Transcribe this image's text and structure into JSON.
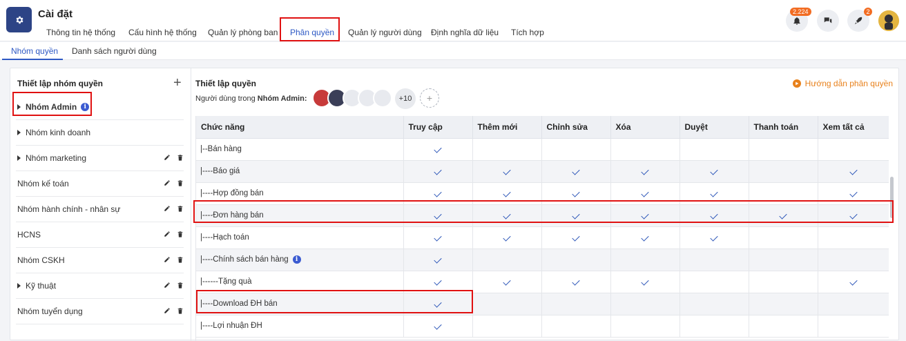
{
  "app": {
    "title": "Cài đặt"
  },
  "main_tabs": [
    {
      "label": "Thông tin hệ thống"
    },
    {
      "label": "Cấu hình hệ thống"
    },
    {
      "label": "Quản lý phòng ban"
    },
    {
      "label": "Phân quyền"
    },
    {
      "label": "Quản lý người dùng"
    },
    {
      "label": "Định nghĩa dữ liệu"
    },
    {
      "label": "Tích hợp"
    }
  ],
  "header": {
    "notification_badge": "2.224",
    "rocket_badge": "2"
  },
  "sub_tabs": [
    {
      "label": "Nhóm quyền"
    },
    {
      "label": "Danh sách người dùng"
    }
  ],
  "left": {
    "title": "Thiết lập nhóm quyền",
    "groups": [
      {
        "label": "Nhóm Admin"
      },
      {
        "label": "Nhóm kinh doanh"
      },
      {
        "label": "Nhóm marketing"
      },
      {
        "label": "Nhóm kế toán"
      },
      {
        "label": "Nhóm hành chính - nhân sự"
      },
      {
        "label": "HCNS"
      },
      {
        "label": "Nhóm CSKH"
      },
      {
        "label": "Kỹ thuật"
      },
      {
        "label": "Nhóm tuyển dụng"
      }
    ]
  },
  "right": {
    "title": "Thiết lập quyền",
    "users_prefix": "Người dùng trong ",
    "users_group": "Nhóm Admin:",
    "more_count": "+10",
    "guide_link": "Hướng dẫn phân quyền"
  },
  "table": {
    "headers": [
      "Chức năng",
      "Truy cập",
      "Thêm mới",
      "Chỉnh sửa",
      "Xóa",
      "Duyệt",
      "Thanh toán",
      "Xem tất cả"
    ],
    "rows": [
      {
        "name": "|--Bán hàng",
        "checks": [
          1,
          0,
          0,
          0,
          0,
          0,
          0
        ]
      },
      {
        "name": "|----Báo giá",
        "checks": [
          1,
          1,
          1,
          1,
          1,
          0,
          1
        ]
      },
      {
        "name": "|----Hợp đồng bán",
        "checks": [
          1,
          1,
          1,
          1,
          1,
          0,
          1
        ]
      },
      {
        "name": "|----Đơn hàng bán",
        "checks": [
          1,
          1,
          1,
          1,
          1,
          1,
          1
        ]
      },
      {
        "name": "|----Hạch toán",
        "checks": [
          1,
          1,
          1,
          1,
          1,
          0,
          0
        ]
      },
      {
        "name": "|----Chính sách bán hàng",
        "checks": [
          1,
          0,
          0,
          0,
          0,
          0,
          0
        ]
      },
      {
        "name": "|------Tặng quà",
        "checks": [
          1,
          1,
          1,
          1,
          0,
          0,
          1
        ]
      },
      {
        "name": "|----Download ĐH bán",
        "checks": [
          1,
          0,
          0,
          0,
          0,
          0,
          0
        ]
      },
      {
        "name": "|----Lợi nhuận ĐH",
        "checks": [
          1,
          0,
          0,
          0,
          0,
          0,
          0
        ]
      }
    ]
  }
}
